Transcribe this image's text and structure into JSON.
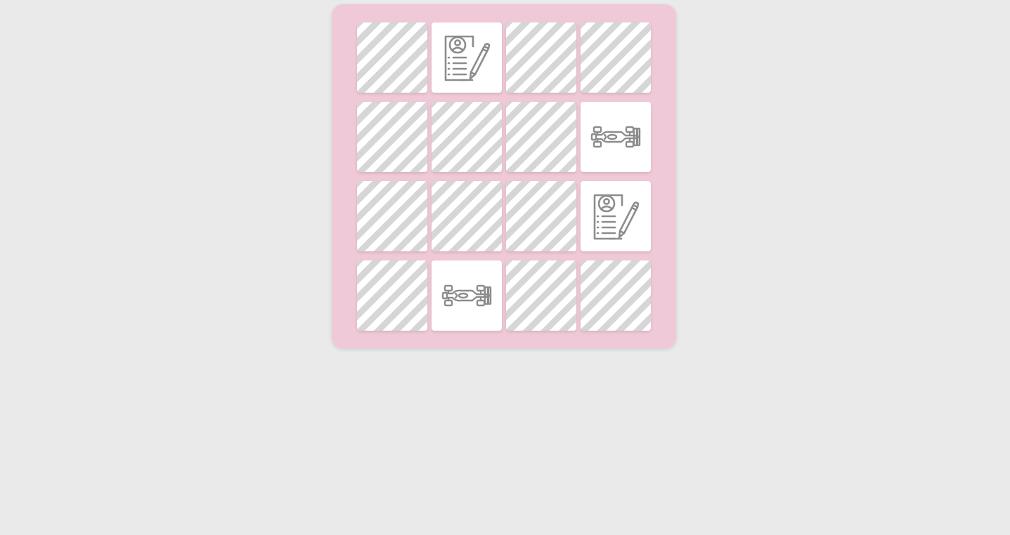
{
  "game": {
    "colors": {
      "background": "#eaeaea",
      "board": "#f0c9d8",
      "card_face": "#ffffff",
      "card_stripe": "#d6d6d6",
      "icon_stroke": "#8c8c8c"
    },
    "grid": {
      "rows": 4,
      "columns": 4
    },
    "cards": [
      {
        "state": "face-down",
        "icon": null
      },
      {
        "state": "face-up",
        "icon": "resume-form-icon"
      },
      {
        "state": "face-down",
        "icon": null
      },
      {
        "state": "face-down",
        "icon": null
      },
      {
        "state": "face-down",
        "icon": null
      },
      {
        "state": "face-down",
        "icon": null
      },
      {
        "state": "face-down",
        "icon": null
      },
      {
        "state": "face-up",
        "icon": "race-car-icon"
      },
      {
        "state": "face-down",
        "icon": null
      },
      {
        "state": "face-down",
        "icon": null
      },
      {
        "state": "face-down",
        "icon": null
      },
      {
        "state": "face-up",
        "icon": "resume-form-icon"
      },
      {
        "state": "face-down",
        "icon": null
      },
      {
        "state": "face-up",
        "icon": "race-car-icon"
      },
      {
        "state": "face-down",
        "icon": null
      },
      {
        "state": "face-down",
        "icon": null
      }
    ]
  }
}
